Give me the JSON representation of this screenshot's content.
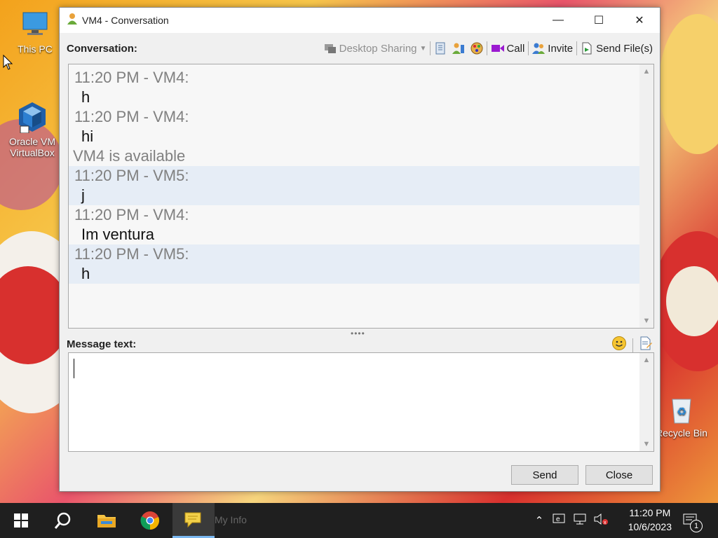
{
  "desktop": {
    "icons": [
      {
        "label_line1": "This PC",
        "label_line2": ""
      },
      {
        "label_line1": "Oracle VM",
        "label_line2": "VirtualBox"
      },
      {
        "label_line1": "Recycle Bin",
        "label_line2": ""
      }
    ]
  },
  "window": {
    "title": "VM4 - Conversation",
    "minimize": "—",
    "maximize": "☐",
    "close": "✕"
  },
  "toolbar": {
    "conversation_label": "Conversation:",
    "desktop_sharing": "Desktop Sharing",
    "call": "Call",
    "invite": "Invite",
    "send_files": "Send File(s)"
  },
  "conversation": {
    "messages": [
      {
        "header": "11:20 PM - VM4:",
        "text": "h",
        "alt": false
      },
      {
        "header": "11:20 PM - VM4:",
        "text": "hi",
        "alt": false
      }
    ],
    "status": "VM4 is available",
    "messages2": [
      {
        "header": "11:20 PM - VM5:",
        "text": "j",
        "alt": true
      },
      {
        "header": "11:20 PM - VM4:",
        "text": "Im ventura",
        "alt": false
      },
      {
        "header": "11:20 PM - VM5:",
        "text": "h",
        "alt": true
      }
    ]
  },
  "message_area": {
    "label": "Message text:",
    "value": ""
  },
  "buttons": {
    "send": "Send",
    "close": "Close"
  },
  "taskbar": {
    "ghost_text": "My Info",
    "time": "11:20 PM",
    "date": "10/6/2023",
    "notification_count": "1"
  },
  "colors": {
    "accent": "#7ab7f0",
    "alt_row": "#e6edf6",
    "header_text": "#808080"
  }
}
